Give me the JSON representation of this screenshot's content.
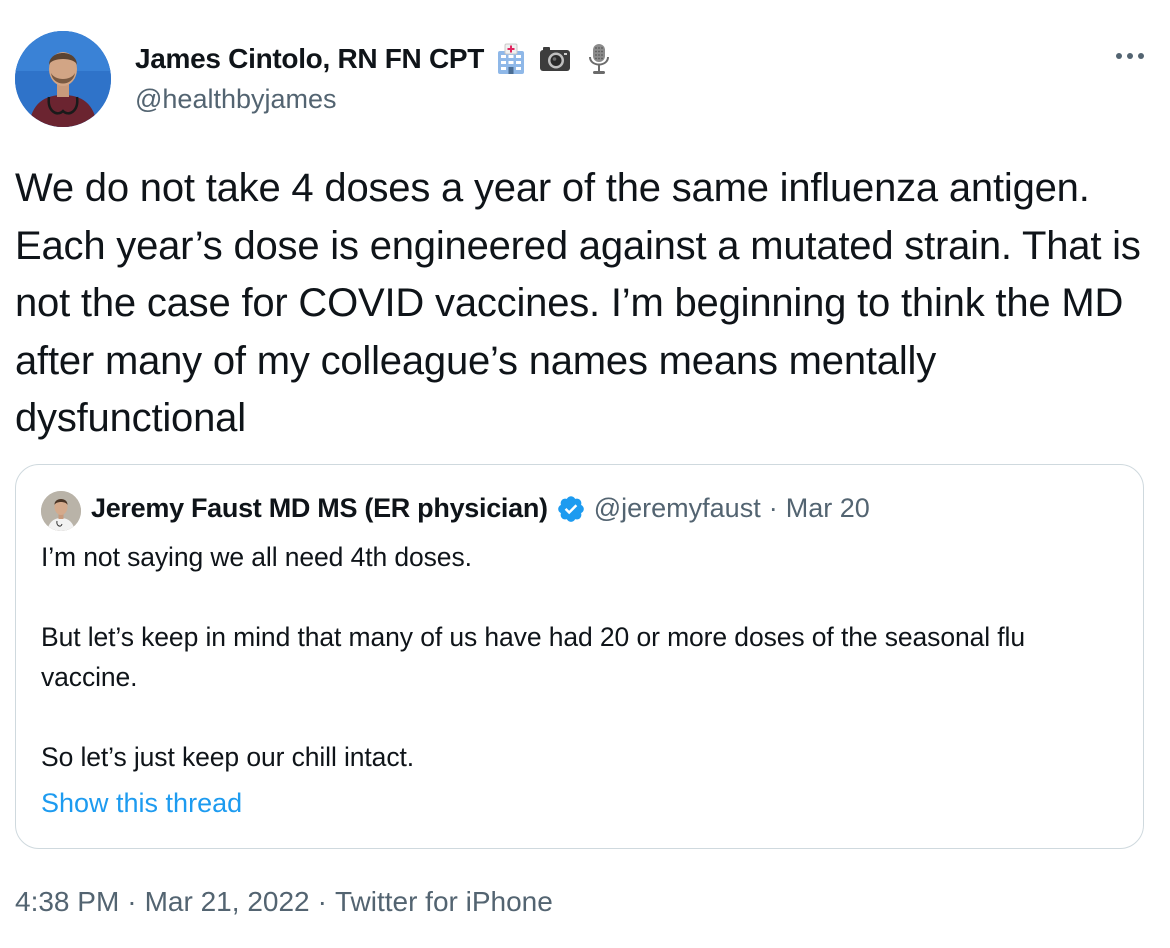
{
  "author": {
    "name": "James Cintolo, RN FN CPT",
    "handle": "@healthbyjames",
    "emojis": [
      "hospital-icon",
      "camera-icon",
      "microphone-icon"
    ]
  },
  "tweet": {
    "text": "We do not take 4 doses a year of the same influenza antigen. Each year’s dose is engineered against a mutated strain. That is not the case for COVID vaccines. I’m beginning to think the MD after many of my colleague’s names means mentally dysfunctional"
  },
  "quoted_tweet": {
    "name": "Jeremy Faust MD MS (ER physician)",
    "verified": true,
    "handle": "@jeremyfaust",
    "separator": "·",
    "date": "Mar 20",
    "paragraphs": [
      "I’m not saying we all need 4th doses.",
      "But let’s keep in mind that many of us have had 20 or more doses of the seasonal flu vaccine.",
      "So let’s just keep our chill intact."
    ],
    "show_thread_label": "Show this thread"
  },
  "meta": {
    "time": "4:38 PM",
    "separator": "·",
    "date": "Mar 21, 2022",
    "source": "Twitter for iPhone"
  },
  "colors": {
    "text": "#0f1419",
    "secondary": "#536471",
    "link": "#1d9bf0",
    "border": "#cfd9de",
    "verified": "#1d9bf0"
  }
}
